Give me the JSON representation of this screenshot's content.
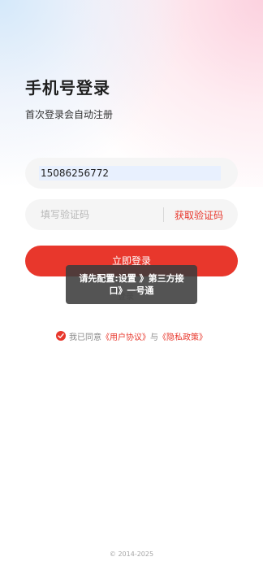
{
  "header": {
    "title": "手机号登录",
    "subtitle": "首次登录会自动注册"
  },
  "form": {
    "phone_value": "15086256772",
    "code_placeholder": "填写验证码",
    "get_code_label": "获取验证码",
    "login_label": "立即登录",
    "under_toast_text": "登录"
  },
  "toast": {
    "message": "请先配置:设置 》第三方接口》一号通"
  },
  "agreement": {
    "checked": true,
    "prefix": "我已同意",
    "user_agreement": "《用户协议》",
    "conjunction": "与",
    "privacy_policy": "《隐私政策》"
  },
  "footer": {
    "copyright": "© 2014-2025"
  },
  "colors": {
    "accent": "#e8372c",
    "field_bg": "#f5f5f5",
    "autofill_bg": "#e8f0fe",
    "toast_bg": "#3c3c3c"
  }
}
